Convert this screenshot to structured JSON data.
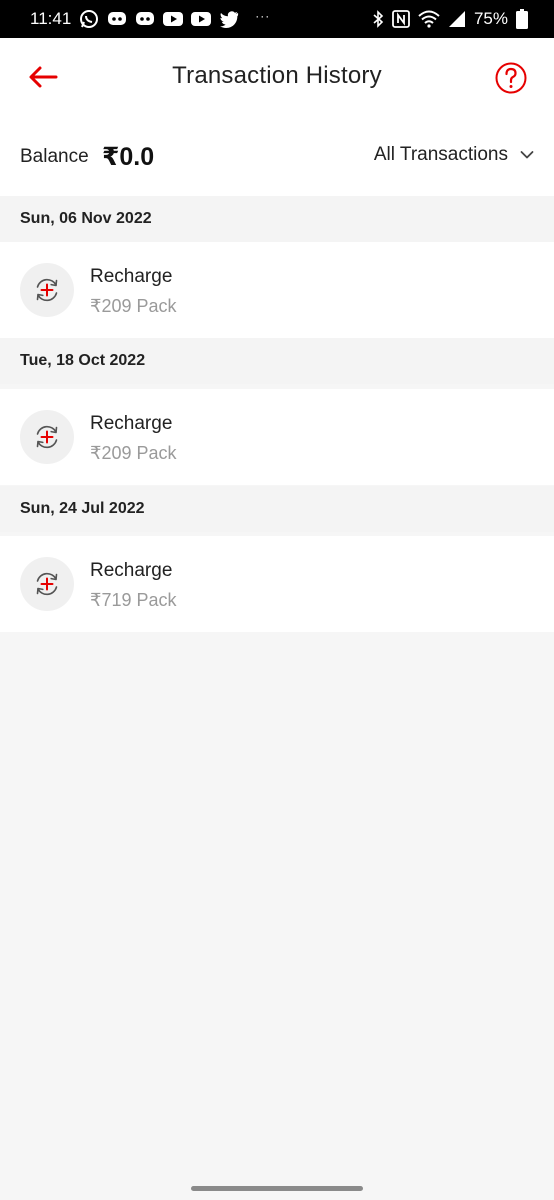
{
  "status_bar": {
    "time": "11:41",
    "battery": "75%",
    "notification_icons": [
      "whatsapp-icon",
      "discord-icon",
      "discord-icon",
      "youtube-icon",
      "youtube-icon",
      "twitter-icon"
    ],
    "system_icons": [
      "bluetooth-icon",
      "nfc-icon",
      "wifi-icon",
      "signal-icon",
      "battery-icon"
    ]
  },
  "header": {
    "title": "Transaction History",
    "accent_color": "#e60000"
  },
  "balance": {
    "label": "Balance",
    "value": "₹0.0"
  },
  "filter": {
    "selected": "All Transactions"
  },
  "groups": [
    {
      "date": "Sun, 06 Nov 2022",
      "transactions": [
        {
          "title": "Recharge",
          "subtitle": "₹209 Pack",
          "icon": "recharge-icon"
        }
      ]
    },
    {
      "date": "Tue, 18 Oct 2022",
      "transactions": [
        {
          "title": "Recharge",
          "subtitle": "₹209 Pack",
          "icon": "recharge-icon"
        }
      ]
    },
    {
      "date": "Sun, 24 Jul 2022",
      "transactions": [
        {
          "title": "Recharge",
          "subtitle": "₹719 Pack",
          "icon": "recharge-icon"
        }
      ]
    }
  ]
}
